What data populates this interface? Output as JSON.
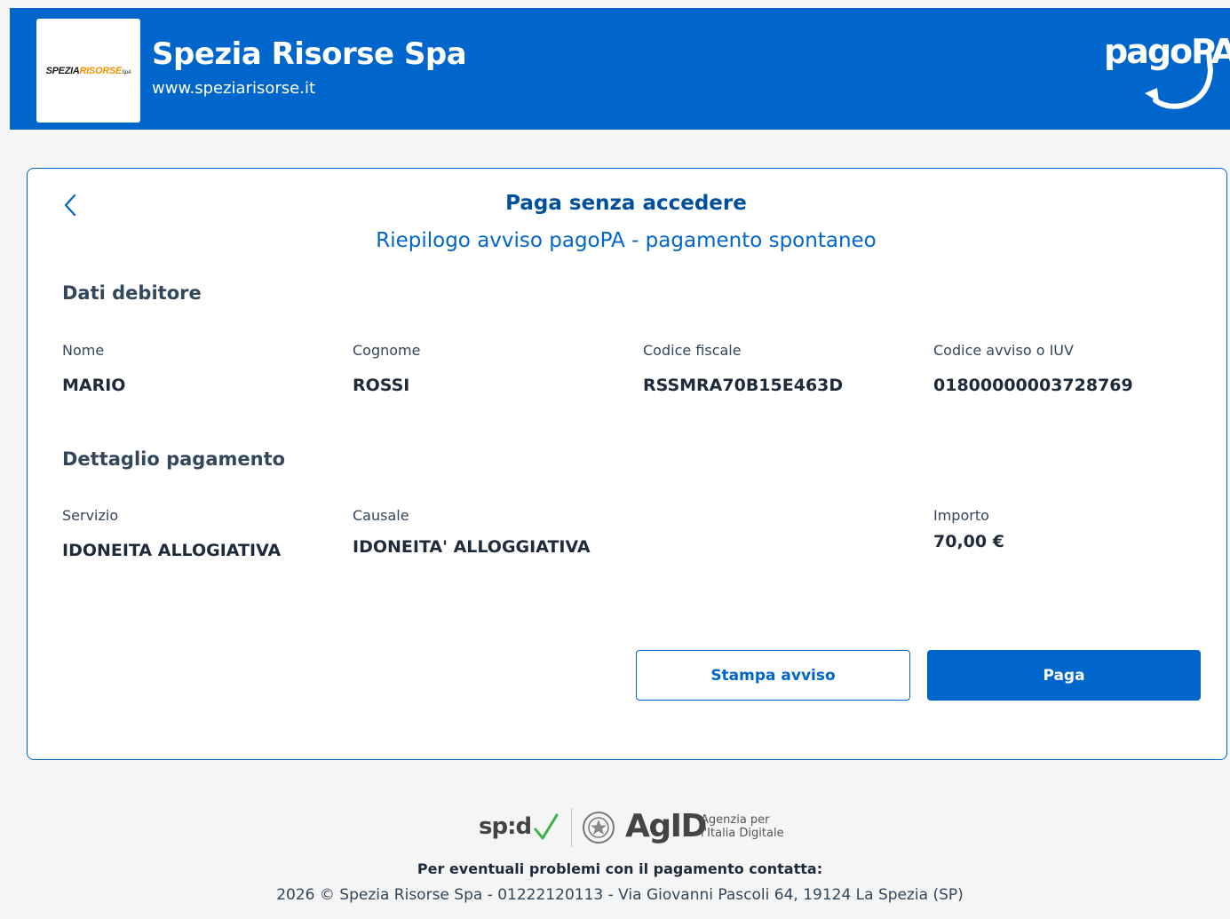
{
  "header": {
    "logo": {
      "part1": "SPEZIA",
      "part2": "RISORSE",
      "part3": "SpA"
    },
    "org_name": "Spezia Risorse Spa",
    "org_url": "www.speziarisorse.it",
    "pagopa_logo_text": "pagoPA"
  },
  "card": {
    "title": "Paga senza accedere",
    "subtitle": "Riepilogo avviso pagoPA - pagamento spontaneo",
    "debtor_section": {
      "title": "Dati debitore",
      "fields": [
        {
          "label": "Nome",
          "value": "MARIO"
        },
        {
          "label": "Cognome",
          "value": "ROSSI"
        },
        {
          "label": "Codice fiscale",
          "value": "RSSMRA70B15E463D"
        },
        {
          "label": "Codice avviso o IUV",
          "value": "01800000003728769"
        }
      ]
    },
    "payment_section": {
      "title": "Dettaglio pagamento",
      "fields": [
        {
          "label": "Servizio",
          "value": "IDONEITA ALLOGIATIVA"
        },
        {
          "label": "Causale",
          "value": "IDONEITA' ALLOGGIATIVA"
        },
        {
          "label": "Importo",
          "value": "70,00 €"
        }
      ]
    },
    "buttons": {
      "print_label": "Stampa avviso",
      "pay_label": "Paga"
    }
  },
  "footer": {
    "spid_text": "sp:d",
    "agid_text": "AgID",
    "agid_sub_line1": "Agenzia per",
    "agid_sub_line2": "l'Italia Digitale",
    "contact": "Per eventuali problemi con il pagamento contatta:",
    "info": "2026 © Spezia Risorse Spa - 01222120113 - Via Giovanni Pascoli 64, 19124 La Spezia (SP)"
  },
  "colors": {
    "primary": "#0066cc",
    "background": "#f5f5f5",
    "logo_accent": "#f39200"
  }
}
